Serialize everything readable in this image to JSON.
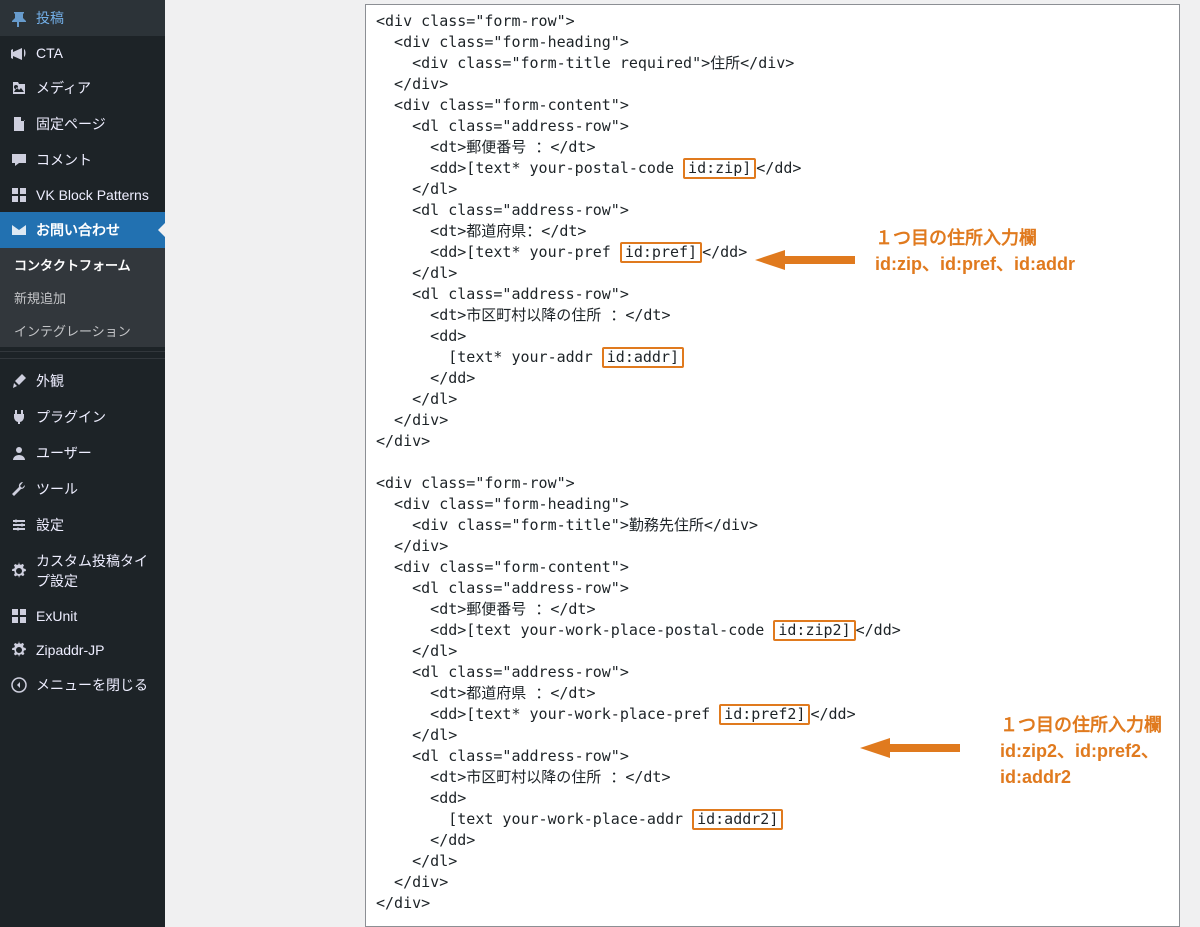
{
  "sidebar": {
    "items": [
      {
        "name": "posts",
        "icon": "pin",
        "label": "投稿"
      },
      {
        "name": "cta",
        "icon": "megaphone",
        "label": "CTA"
      },
      {
        "name": "media",
        "icon": "media",
        "label": "メディア"
      },
      {
        "name": "pages",
        "icon": "page",
        "label": "固定ページ"
      },
      {
        "name": "comments",
        "icon": "comment",
        "label": "コメント"
      },
      {
        "name": "vk-patterns",
        "icon": "grid",
        "label": "VK Block Patterns"
      },
      {
        "name": "contact",
        "icon": "mail",
        "label": "お問い合わせ"
      }
    ],
    "active": "contact",
    "submenu": [
      {
        "name": "contact-forms",
        "label": "コンタクトフォーム",
        "current": true
      },
      {
        "name": "add-new",
        "label": "新規追加"
      },
      {
        "name": "integration",
        "label": "インテグレーション"
      }
    ],
    "items2": [
      {
        "name": "appearance",
        "icon": "brush",
        "label": "外観"
      },
      {
        "name": "plugins",
        "icon": "plug",
        "label": "プラグイン"
      },
      {
        "name": "users",
        "icon": "user",
        "label": "ユーザー"
      },
      {
        "name": "tools",
        "icon": "wrench",
        "label": "ツール"
      },
      {
        "name": "settings",
        "icon": "sliders",
        "label": "設定"
      },
      {
        "name": "cpt",
        "icon": "gear",
        "label": "カスタム投稿タイプ設定"
      },
      {
        "name": "exunit",
        "icon": "grid",
        "label": "ExUnit"
      },
      {
        "name": "zipaddr",
        "icon": "gear",
        "label": "Zipaddr-JP"
      },
      {
        "name": "collapse",
        "icon": "collapse",
        "label": "メニューを閉じる"
      }
    ]
  },
  "code": {
    "t": {
      "divOpenFormRow": "<div class=\"form-row\">",
      "divOpenHeading": "  <div class=\"form-heading\">",
      "titleReqOpen": "    <div class=\"form-title required\">",
      "titleOpen": "    <div class=\"form-title\">",
      "title1": "住所",
      "title2": "勤務先住所",
      "divClose": "</div>",
      "divClose_i1": "  </div>",
      "divClose_i2": "    </div>",
      "divOpenContent": "  <div class=\"form-content\">",
      "dlOpen": "    <dl class=\"address-row\">",
      "dtZip": "      <dt>郵便番号 ：</dt>",
      "dtPref": "      <dt>都道府県：</dt>",
      "dtPref2": "      <dt>都道府県 ：</dt>",
      "dtAddr": "      <dt>市区町村以降の住所 ：</dt>",
      "ddZipPre": "      <dd>[text* your-postal-code ",
      "ddZipHl": "id:zip]",
      "ddZipPost": "</dd>",
      "ddPrefPre": "      <dd>[text* your-pref ",
      "ddPrefHl": "id:pref]",
      "ddPrefPost": "</dd>",
      "ddOpen": "      <dd>",
      "addrLinePre": "        [text* your-addr ",
      "addrLineHl": "id:addr]",
      "ddClose": "      </dd>",
      "dlClose": "    </dl>",
      "blank": "",
      "ddZip2Pre": "      <dd>[text your-work-place-postal-code ",
      "ddZip2Hl": "id:zip2]",
      "ddZip2Post": "</dd>",
      "ddPref2Pre": "      <dd>[text* your-work-place-pref ",
      "ddPref2Hl": "id:pref2]",
      "ddPref2Post": "</dd>",
      "addr2LinePre": "        [text your-work-place-addr ",
      "addr2LineHl": "id:addr2]"
    }
  },
  "annotations": {
    "first": {
      "line1": "１つ目の住所入力欄",
      "line2": "id:zip、id:pref、id:addr"
    },
    "second": {
      "line1": "１つ目の住所入力欄",
      "line2": "id:zip2、id:pref2、id:addr2"
    }
  }
}
